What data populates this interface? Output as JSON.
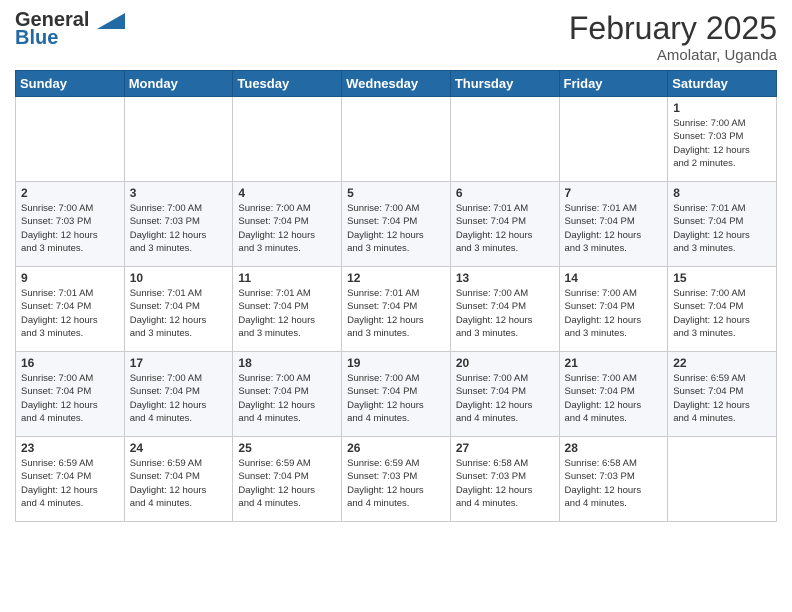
{
  "header": {
    "logo_general": "General",
    "logo_blue": "Blue",
    "month_title": "February 2025",
    "location": "Amolatar, Uganda"
  },
  "days_of_week": [
    "Sunday",
    "Monday",
    "Tuesday",
    "Wednesday",
    "Thursday",
    "Friday",
    "Saturday"
  ],
  "weeks": [
    [
      {
        "day": "",
        "info": ""
      },
      {
        "day": "",
        "info": ""
      },
      {
        "day": "",
        "info": ""
      },
      {
        "day": "",
        "info": ""
      },
      {
        "day": "",
        "info": ""
      },
      {
        "day": "",
        "info": ""
      },
      {
        "day": "1",
        "info": "Sunrise: 7:00 AM\nSunset: 7:03 PM\nDaylight: 12 hours\nand 2 minutes."
      }
    ],
    [
      {
        "day": "2",
        "info": "Sunrise: 7:00 AM\nSunset: 7:03 PM\nDaylight: 12 hours\nand 3 minutes."
      },
      {
        "day": "3",
        "info": "Sunrise: 7:00 AM\nSunset: 7:03 PM\nDaylight: 12 hours\nand 3 minutes."
      },
      {
        "day": "4",
        "info": "Sunrise: 7:00 AM\nSunset: 7:04 PM\nDaylight: 12 hours\nand 3 minutes."
      },
      {
        "day": "5",
        "info": "Sunrise: 7:00 AM\nSunset: 7:04 PM\nDaylight: 12 hours\nand 3 minutes."
      },
      {
        "day": "6",
        "info": "Sunrise: 7:01 AM\nSunset: 7:04 PM\nDaylight: 12 hours\nand 3 minutes."
      },
      {
        "day": "7",
        "info": "Sunrise: 7:01 AM\nSunset: 7:04 PM\nDaylight: 12 hours\nand 3 minutes."
      },
      {
        "day": "8",
        "info": "Sunrise: 7:01 AM\nSunset: 7:04 PM\nDaylight: 12 hours\nand 3 minutes."
      }
    ],
    [
      {
        "day": "9",
        "info": "Sunrise: 7:01 AM\nSunset: 7:04 PM\nDaylight: 12 hours\nand 3 minutes."
      },
      {
        "day": "10",
        "info": "Sunrise: 7:01 AM\nSunset: 7:04 PM\nDaylight: 12 hours\nand 3 minutes."
      },
      {
        "day": "11",
        "info": "Sunrise: 7:01 AM\nSunset: 7:04 PM\nDaylight: 12 hours\nand 3 minutes."
      },
      {
        "day": "12",
        "info": "Sunrise: 7:01 AM\nSunset: 7:04 PM\nDaylight: 12 hours\nand 3 minutes."
      },
      {
        "day": "13",
        "info": "Sunrise: 7:00 AM\nSunset: 7:04 PM\nDaylight: 12 hours\nand 3 minutes."
      },
      {
        "day": "14",
        "info": "Sunrise: 7:00 AM\nSunset: 7:04 PM\nDaylight: 12 hours\nand 3 minutes."
      },
      {
        "day": "15",
        "info": "Sunrise: 7:00 AM\nSunset: 7:04 PM\nDaylight: 12 hours\nand 3 minutes."
      }
    ],
    [
      {
        "day": "16",
        "info": "Sunrise: 7:00 AM\nSunset: 7:04 PM\nDaylight: 12 hours\nand 4 minutes."
      },
      {
        "day": "17",
        "info": "Sunrise: 7:00 AM\nSunset: 7:04 PM\nDaylight: 12 hours\nand 4 minutes."
      },
      {
        "day": "18",
        "info": "Sunrise: 7:00 AM\nSunset: 7:04 PM\nDaylight: 12 hours\nand 4 minutes."
      },
      {
        "day": "19",
        "info": "Sunrise: 7:00 AM\nSunset: 7:04 PM\nDaylight: 12 hours\nand 4 minutes."
      },
      {
        "day": "20",
        "info": "Sunrise: 7:00 AM\nSunset: 7:04 PM\nDaylight: 12 hours\nand 4 minutes."
      },
      {
        "day": "21",
        "info": "Sunrise: 7:00 AM\nSunset: 7:04 PM\nDaylight: 12 hours\nand 4 minutes."
      },
      {
        "day": "22",
        "info": "Sunrise: 6:59 AM\nSunset: 7:04 PM\nDaylight: 12 hours\nand 4 minutes."
      }
    ],
    [
      {
        "day": "23",
        "info": "Sunrise: 6:59 AM\nSunset: 7:04 PM\nDaylight: 12 hours\nand 4 minutes."
      },
      {
        "day": "24",
        "info": "Sunrise: 6:59 AM\nSunset: 7:04 PM\nDaylight: 12 hours\nand 4 minutes."
      },
      {
        "day": "25",
        "info": "Sunrise: 6:59 AM\nSunset: 7:04 PM\nDaylight: 12 hours\nand 4 minutes."
      },
      {
        "day": "26",
        "info": "Sunrise: 6:59 AM\nSunset: 7:03 PM\nDaylight: 12 hours\nand 4 minutes."
      },
      {
        "day": "27",
        "info": "Sunrise: 6:58 AM\nSunset: 7:03 PM\nDaylight: 12 hours\nand 4 minutes."
      },
      {
        "day": "28",
        "info": "Sunrise: 6:58 AM\nSunset: 7:03 PM\nDaylight: 12 hours\nand 4 minutes."
      },
      {
        "day": "",
        "info": ""
      }
    ]
  ]
}
